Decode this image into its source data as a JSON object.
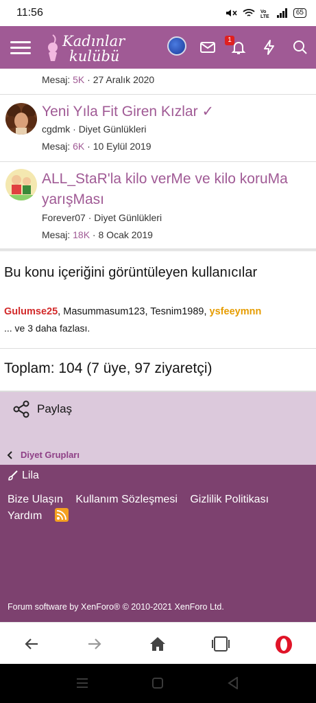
{
  "status_bar": {
    "time": "11:56",
    "icons": [
      "mute-icon",
      "wifi-icon",
      "volte-icon",
      "signal-icon"
    ],
    "battery": "65"
  },
  "header": {
    "logo_text_line1": "Kadınlar",
    "logo_text_line2": "kulübü",
    "notification_count": "1",
    "brand_color": "#a05a95"
  },
  "threads": [
    {
      "avatar": "user-avatar",
      "title": "",
      "author": "",
      "forum": "",
      "replies_label": "Mesaj:",
      "replies": "5K",
      "date": "27 Aralık 2020"
    },
    {
      "avatar": "curly-hair-avatar",
      "title": "Yeni Yıla Fit Giren Kızlar",
      "author": "cgdmk",
      "forum": "Diyet Günlükleri",
      "replies_label": "Mesaj:",
      "replies": "6K",
      "date": "10 Eylül 2019"
    },
    {
      "avatar": "cartoon-avatar",
      "title": "ALL_StaR'la kilo verMe ve kilo koruMa yarışMası",
      "author": "Forever07",
      "forum": "Diyet Günlükleri",
      "replies_label": "Mesaj:",
      "replies": "18K",
      "date": "8 Ocak 2019"
    }
  ],
  "viewers": {
    "title": "Bu konu içeriğini görüntüleyen kullanıcılar",
    "users": [
      "Gulumse25",
      "Masummasum123",
      "Tesnim1989",
      "ysfeeymnn"
    ],
    "more": "... ve 3 daha fazlası."
  },
  "total": "Toplam: 104 (7 üye, 97 ziyaretçi)",
  "share_label": "Paylaş",
  "breadcrumb": "Diyet Grupları",
  "footer": {
    "style_name": "Lila",
    "links": [
      "Bize Ulaşın",
      "Kullanım Sözleşmesi",
      "Gizlilik Politikası",
      "Yardım"
    ],
    "copyright": "Forum software by XenForo® © 2010-2021 XenForo Ltd."
  },
  "colors": {
    "accent": "#a05a95",
    "footer_bg": "#7d416f",
    "share_bg": "#dcc9dc",
    "user_red": "#d22a2a",
    "user_orange": "#e69c00"
  }
}
